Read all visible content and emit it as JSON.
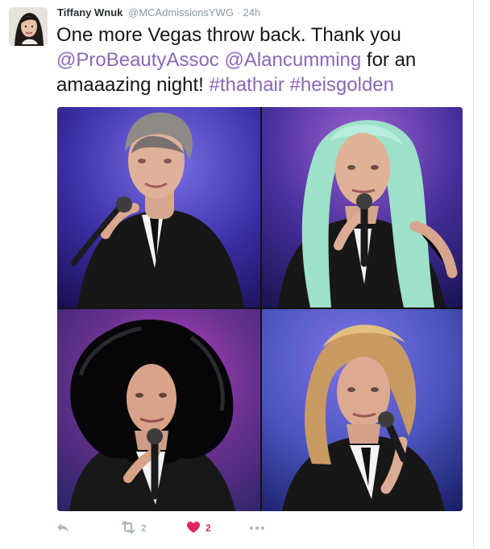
{
  "tweet": {
    "name": "Tiffany Wnuk",
    "handle": "@MCAdmissionsYWG",
    "separator": "·",
    "time": "24h",
    "text_plain_1": "One more Vegas throw back. Thank you ",
    "mention_1": "@ProBeautyAssoc",
    "mention_2": "@Alancumming",
    "text_plain_2": " for an amaaazing night! ",
    "hashtag_1": "#thathair",
    "hashtag_2": "#heisgolden",
    "retweet_count": "2",
    "like_count": "2"
  },
  "colors": {
    "link": "#8b67b8",
    "like": "#e0245e",
    "muted": "#8899a6",
    "action_icon": "#aab8c2"
  },
  "icons": {
    "reply": "reply-icon",
    "retweet": "retweet-icon",
    "like": "heart-icon",
    "more": "more-dots-icon"
  }
}
